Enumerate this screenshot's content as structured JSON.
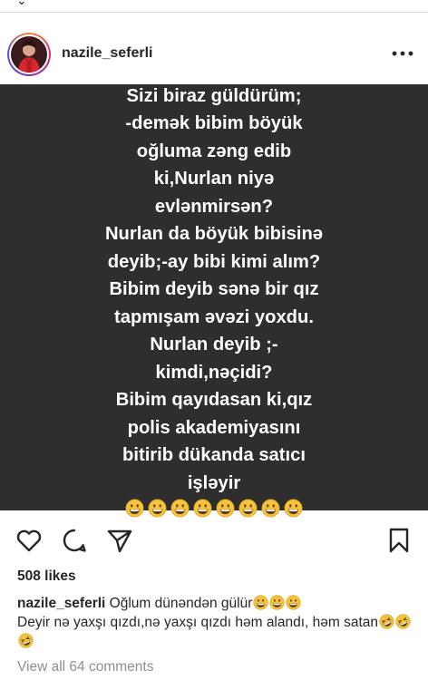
{
  "post": {
    "username": "nazile_seferli",
    "image_text": "Sizi biraz güldürüm;\n-demək bibim böyük\noğluma zəng edib\nki,Nurlan niyə\nevlənmirsən?\nNurlan da böyük bibisinə\ndeyib;-ay bibi kimi alım?\nBibim deyib sənə bir qız\ntapmışam əvəzi yoxdu.\nNurlan deyib ;-\nkimdi,nəçidi?\nBibim qayıdasan ki,qız\npolis akademiyasını\nbitirib dükanda satıcı\nişləyir",
    "image_emojis": [
      "grinning-face",
      "grinning-face",
      "grinning-face",
      "grinning-face",
      "grinning-face",
      "grinning-face",
      "grinning-face",
      "grinning-face"
    ],
    "likes": "508 likes",
    "caption": {
      "username": "nazile_seferli",
      "line1": "Oğlum dünəndən gülür",
      "line1_emojis": [
        "grinning-face",
        "grinning-face",
        "grinning-face"
      ],
      "line2": "Deyir nə yaxşı qızdı,nə yaxşı qızdı həm alandı, həm satan",
      "line2_emojis": [
        "rolling-on-floor-laughing",
        "rolling-on-floor-laughing",
        "rolling-on-floor-laughing"
      ]
    },
    "view_comments": "View all 64 comments"
  },
  "icons": {
    "more": "more-horizontal-icon",
    "like": "heart-icon",
    "comment": "comment-icon",
    "share": "paper-plane-icon",
    "save": "bookmark-icon"
  },
  "colors": {
    "post_background": "#2e2e2e",
    "text_primary": "#262626",
    "text_secondary": "#8e8e8e",
    "emoji_face": "#f7c23b"
  }
}
